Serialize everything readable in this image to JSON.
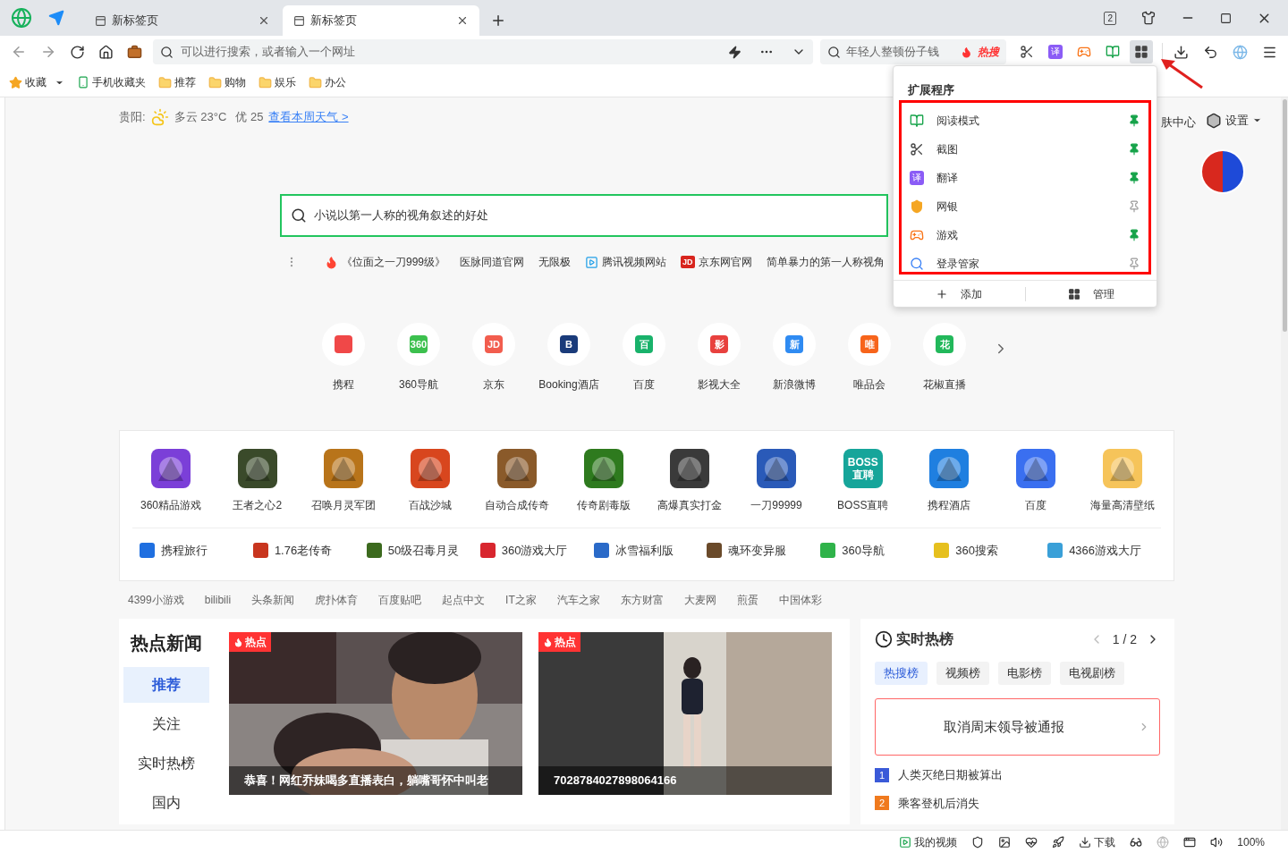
{
  "window": {
    "tab_count": "2"
  },
  "tabs": [
    {
      "title": "新标签页",
      "selected": false
    },
    {
      "title": "新标签页",
      "selected": true
    }
  ],
  "address": {
    "placeholder": "可以进行搜索，或者输入一个网址"
  },
  "search_box": {
    "text": "年轻人整顿份子钱",
    "badge": "热搜"
  },
  "toolbar": [
    {
      "kind": "scissors",
      "active": false
    },
    {
      "kind": "translate",
      "glyph": "译",
      "active": false
    },
    {
      "kind": "game",
      "active": false
    },
    {
      "kind": "book",
      "active": false
    },
    {
      "kind": "extensions",
      "active": true
    }
  ],
  "bookmarks": [
    {
      "kind": "star",
      "label": "收藏"
    },
    {
      "kind": "phone",
      "label": "手机收藏夹"
    },
    {
      "kind": "folder",
      "label": "推荐"
    },
    {
      "kind": "folder",
      "label": "购物"
    },
    {
      "kind": "folder",
      "label": "娱乐"
    },
    {
      "kind": "folder",
      "label": "办公"
    }
  ],
  "weather": {
    "city": "贵阳:",
    "condition": "多云 23°C",
    "air": "优 25",
    "link": "查看本周天气 >"
  },
  "top_right": {
    "skin": "肤中心",
    "settings": "设置"
  },
  "main_search": {
    "value": "小说以第一人称的视角叙述的好处"
  },
  "hot_links": [
    {
      "kind": "fire",
      "text": "《位面之一刀999级》"
    },
    {
      "kind": "plain",
      "text": "医脉同道官网"
    },
    {
      "kind": "plain",
      "text": "无限极"
    },
    {
      "kind": "video",
      "text": "腾讯视频网站"
    },
    {
      "kind": "badge",
      "badge": "JD",
      "text": "京东网官网"
    },
    {
      "kind": "plain",
      "text": "简单暴力的第一人称视角"
    }
  ],
  "sites": [
    {
      "label": "携程",
      "color": "#f04848"
    },
    {
      "label": "360导航",
      "color": "#3cc04e",
      "glyph": "360"
    },
    {
      "label": "京东",
      "color": "#f25d4e",
      "glyph": "JD"
    },
    {
      "label": "Booking酒店",
      "color": "#1a3b7a",
      "glyph": "B"
    },
    {
      "label": "百度",
      "color": "#19b26b",
      "glyph": "百"
    },
    {
      "label": "影视大全",
      "color": "#e8413e",
      "glyph": "影"
    },
    {
      "label": "新浪微博",
      "color": "#2f8bf2",
      "glyph": "新"
    },
    {
      "label": "唯品会",
      "color": "#f7641b",
      "glyph": "唯"
    },
    {
      "label": "花椒直播",
      "color": "#22b85b",
      "glyph": "花"
    }
  ],
  "games": [
    {
      "label": "360精品游戏",
      "color": "#7b3fd8"
    },
    {
      "label": "王者之心2",
      "color": "#3a4a2a"
    },
    {
      "label": "召唤月灵军团",
      "color": "#b8741a"
    },
    {
      "label": "百战沙城",
      "color": "#d8461e"
    },
    {
      "label": "自动合成传奇",
      "color": "#8a5a2a"
    },
    {
      "label": "传奇剧毒版",
      "color": "#2e7a1e"
    },
    {
      "label": "高爆真实打金",
      "color": "#3a3a3a"
    },
    {
      "label": "一刀99999",
      "color": "#2a5ab8"
    },
    {
      "label": "BOSS直聘",
      "color": "#16a59a",
      "glyph": "BOSS直聘"
    },
    {
      "label": "携程酒店",
      "color": "#1f7fe0"
    },
    {
      "label": "百度",
      "color": "#3a6ff0"
    },
    {
      "label": "海量高清壁纸",
      "color": "#f6c45a"
    }
  ],
  "game_links": [
    {
      "label": "携程旅行",
      "color": "#1f6fe0"
    },
    {
      "label": "1.76老传奇",
      "color": "#c8351e"
    },
    {
      "label": "50级召毒月灵",
      "color": "#3c6a1e"
    },
    {
      "label": "360游戏大厅",
      "color": "#d8262e"
    },
    {
      "label": "冰雪福利版",
      "color": "#2a6ac8"
    },
    {
      "label": "魂环变异服",
      "color": "#6a4a2a"
    },
    {
      "label": "360导航",
      "color": "#2fb34a"
    },
    {
      "label": "360搜索",
      "color": "#e6c01e"
    },
    {
      "label": "4366游戏大厅",
      "color": "#3aa0d8"
    }
  ],
  "site_links": [
    "4399小游戏",
    "bilibili",
    "头条新闻",
    "虎扑体育",
    "百度贴吧",
    "起点中文",
    "IT之家",
    "汽车之家",
    "东方财富",
    "大麦网",
    "煎蛋",
    "中国体彩"
  ],
  "news": {
    "title": "热点新闻",
    "nav": [
      {
        "label": "推荐",
        "selected": true
      },
      {
        "label": "关注",
        "selected": false
      },
      {
        "label": "实时热榜",
        "selected": false
      },
      {
        "label": "国内",
        "selected": false
      }
    ],
    "cards": [
      {
        "tag": "热点",
        "caption": "恭喜！网红乔妹喝多直播表白，躺嘴哥怀中叫老"
      },
      {
        "tag": "热点",
        "caption": "7028784027898064166"
      }
    ]
  },
  "hot_list": {
    "title": "实时热榜",
    "page": "1 / 2",
    "tabs": [
      {
        "label": "热搜榜",
        "selected": true
      },
      {
        "label": "视频榜",
        "selected": false
      },
      {
        "label": "电影榜",
        "selected": false
      },
      {
        "label": "电视剧榜",
        "selected": false
      }
    ],
    "top": "取消周末领导被通报",
    "items": [
      {
        "rank": "1",
        "text": "人类灭绝日期被算出",
        "color": "#3a5ad8"
      },
      {
        "rank": "2",
        "text": "乘客登机后消失",
        "color": "#f07a1e"
      }
    ]
  },
  "extensions": {
    "title": "扩展程序",
    "items": [
      {
        "kind": "book",
        "name": "阅读模式",
        "pinned": true
      },
      {
        "kind": "scissors",
        "name": "截图",
        "pinned": true
      },
      {
        "kind": "translate",
        "glyph": "译",
        "name": "翻译",
        "pinned": true
      },
      {
        "kind": "shield",
        "name": "网银",
        "pinned": false
      },
      {
        "kind": "game",
        "name": "游戏",
        "pinned": true
      },
      {
        "kind": "search",
        "name": "登录管家",
        "pinned": false
      }
    ],
    "add": "添加",
    "manage": "管理"
  },
  "status_bar": {
    "video": "我的视频",
    "download": "下载",
    "zoom": "100%"
  }
}
